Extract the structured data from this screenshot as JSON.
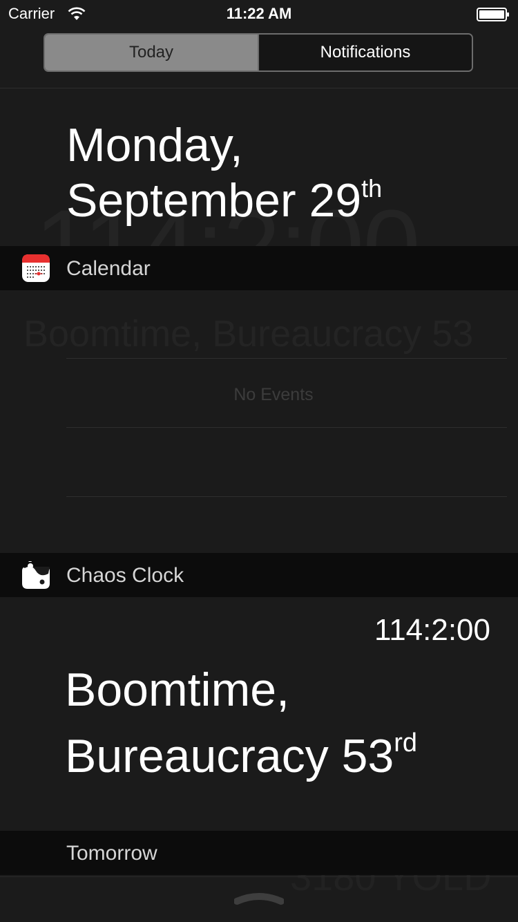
{
  "status_bar": {
    "carrier": "Carrier",
    "time": "11:22 AM"
  },
  "segmented": {
    "tabs": [
      {
        "label": "Today",
        "selected": true
      },
      {
        "label": "Notifications",
        "selected": false
      }
    ]
  },
  "date_header": {
    "line1": "Monday,",
    "line2": "September 29",
    "suffix": "th"
  },
  "calendar_section": {
    "title": "Calendar",
    "empty_text": "No Events"
  },
  "chaos_section": {
    "title": "Chaos Clock",
    "time": "114:2:00",
    "line1": "Boomtime,",
    "line2": "Bureaucracy 53",
    "suffix": "rd"
  },
  "tomorrow_section": {
    "title": "Tomorrow"
  },
  "background_ghost": {
    "time": "114:2:00",
    "date": "Boomtime, Bureaucracy 53",
    "year": "3180 YOLD"
  },
  "colors": {
    "background": "#1b1b1b",
    "section_bar": "#0c0c0c",
    "calendar_red": "#e8302f"
  }
}
